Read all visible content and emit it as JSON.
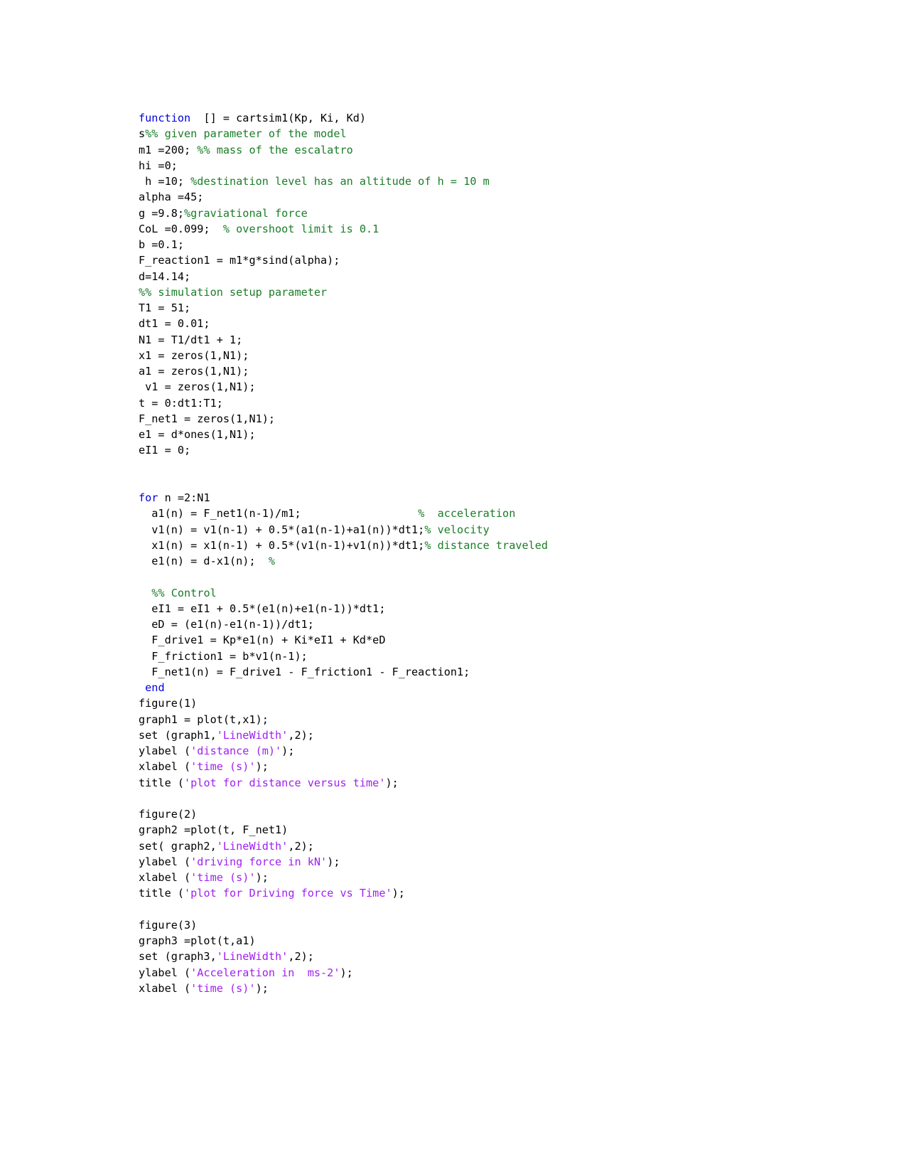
{
  "document": {
    "kind": "matlab-source-listing",
    "language": "MATLAB",
    "function_name": "cartsim1",
    "colors": {
      "background": "#ffffff",
      "text": "#000000",
      "keyword": "#0000e0",
      "comment": "#1a7d27",
      "string": "#a020f0"
    }
  },
  "code": {
    "lines": [
      [
        {
          "t": "function",
          "c": "kw"
        },
        {
          "t": "  [] = cartsim1(Kp, Ki, Kd)",
          "c": "plain"
        }
      ],
      [
        {
          "t": "s",
          "c": "plain"
        },
        {
          "t": "%% given parameter of the model",
          "c": "comment"
        }
      ],
      [
        {
          "t": "m1 =200; ",
          "c": "plain"
        },
        {
          "t": "%% mass of the escalatro",
          "c": "comment"
        }
      ],
      [
        {
          "t": "hi =0;",
          "c": "plain"
        }
      ],
      [
        {
          "t": " h =10; ",
          "c": "plain"
        },
        {
          "t": "%destination level has an altitude of h = 10 m",
          "c": "comment"
        }
      ],
      [
        {
          "t": "alpha =45;",
          "c": "plain"
        }
      ],
      [
        {
          "t": "g =9.8;",
          "c": "plain"
        },
        {
          "t": "%graviational force",
          "c": "comment"
        }
      ],
      [
        {
          "t": "CoL =0.099;  ",
          "c": "plain"
        },
        {
          "t": "% overshoot limit is 0.1",
          "c": "comment"
        }
      ],
      [
        {
          "t": "b =0.1;",
          "c": "plain"
        }
      ],
      [
        {
          "t": "F_reaction1 = m1*g*sind(alpha);",
          "c": "plain"
        }
      ],
      [
        {
          "t": "d=14.14;",
          "c": "plain"
        }
      ],
      [
        {
          "t": "%% simulation setup parameter",
          "c": "comment"
        }
      ],
      [
        {
          "t": "T1 = 51;",
          "c": "plain"
        }
      ],
      [
        {
          "t": "dt1 = 0.01;",
          "c": "plain"
        }
      ],
      [
        {
          "t": "N1 = T1/dt1 + 1;",
          "c": "plain"
        }
      ],
      [
        {
          "t": "x1 = zeros(1,N1);",
          "c": "plain"
        }
      ],
      [
        {
          "t": "a1 = zeros(1,N1);",
          "c": "plain"
        }
      ],
      [
        {
          "t": " v1 = zeros(1,N1);",
          "c": "plain"
        }
      ],
      [
        {
          "t": "t = 0:dt1:T1;",
          "c": "plain"
        }
      ],
      [
        {
          "t": "F_net1 = zeros(1,N1);",
          "c": "plain"
        }
      ],
      [
        {
          "t": "e1 = d*ones(1,N1);",
          "c": "plain"
        }
      ],
      [
        {
          "t": "eI1 = 0;",
          "c": "plain"
        }
      ],
      [],
      [],
      [
        {
          "t": "for",
          "c": "kw"
        },
        {
          "t": " n =2:N1",
          "c": "plain"
        }
      ],
      [
        {
          "t": "  a1(n) = F_net1(n-1)/m1;                  ",
          "c": "plain"
        },
        {
          "t": "%  acceleration",
          "c": "comment"
        }
      ],
      [
        {
          "t": "  v1(n) = v1(n-1) + 0.5*(a1(n-1)+a1(n))*dt1;",
          "c": "plain"
        },
        {
          "t": "% velocity",
          "c": "comment"
        }
      ],
      [
        {
          "t": "  x1(n) = x1(n-1) + 0.5*(v1(n-1)+v1(n))*dt1;",
          "c": "plain"
        },
        {
          "t": "% distance traveled",
          "c": "comment"
        }
      ],
      [
        {
          "t": "  e1(n) = d-x1(n);  ",
          "c": "plain"
        },
        {
          "t": "%",
          "c": "comment"
        }
      ],
      [],
      [
        {
          "t": "  ",
          "c": "plain"
        },
        {
          "t": "%% Control",
          "c": "comment"
        }
      ],
      [
        {
          "t": "  eI1 = eI1 + 0.5*(e1(n)+e1(n-1))*dt1;",
          "c": "plain"
        }
      ],
      [
        {
          "t": "  eD = (e1(n)-e1(n-1))/dt1;",
          "c": "plain"
        }
      ],
      [
        {
          "t": "  F_drive1 = Kp*e1(n) + Ki*eI1 + Kd*eD",
          "c": "plain"
        }
      ],
      [
        {
          "t": "  F_friction1 = b*v1(n-1);",
          "c": "plain"
        }
      ],
      [
        {
          "t": "  F_net1(n) = F_drive1 - F_friction1 - F_reaction1;",
          "c": "plain"
        }
      ],
      [
        {
          "t": " ",
          "c": "plain"
        },
        {
          "t": "end",
          "c": "kw"
        }
      ],
      [
        {
          "t": "figure(1)",
          "c": "plain"
        }
      ],
      [
        {
          "t": "graph1 = plot(t,x1);",
          "c": "plain"
        }
      ],
      [
        {
          "t": "set (graph1,",
          "c": "plain"
        },
        {
          "t": "'LineWidth'",
          "c": "str"
        },
        {
          "t": ",2);",
          "c": "plain"
        }
      ],
      [
        {
          "t": "ylabel (",
          "c": "plain"
        },
        {
          "t": "'distance (m)'",
          "c": "str"
        },
        {
          "t": ");",
          "c": "plain"
        }
      ],
      [
        {
          "t": "xlabel (",
          "c": "plain"
        },
        {
          "t": "'time (s)'",
          "c": "str"
        },
        {
          "t": ");",
          "c": "plain"
        }
      ],
      [
        {
          "t": "title (",
          "c": "plain"
        },
        {
          "t": "'plot for distance versus time'",
          "c": "str"
        },
        {
          "t": ");",
          "c": "plain"
        }
      ],
      [],
      [
        {
          "t": "figure(2)",
          "c": "plain"
        }
      ],
      [
        {
          "t": "graph2 =plot(t, F_net1)",
          "c": "plain"
        }
      ],
      [
        {
          "t": "set( graph2,",
          "c": "plain"
        },
        {
          "t": "'LineWidth'",
          "c": "str"
        },
        {
          "t": ",2);",
          "c": "plain"
        }
      ],
      [
        {
          "t": "ylabel (",
          "c": "plain"
        },
        {
          "t": "'driving force in kN'",
          "c": "str"
        },
        {
          "t": ");",
          "c": "plain"
        }
      ],
      [
        {
          "t": "xlabel (",
          "c": "plain"
        },
        {
          "t": "'time (s)'",
          "c": "str"
        },
        {
          "t": ");",
          "c": "plain"
        }
      ],
      [
        {
          "t": "title (",
          "c": "plain"
        },
        {
          "t": "'plot for Driving force vs Time'",
          "c": "str"
        },
        {
          "t": ");",
          "c": "plain"
        }
      ],
      [],
      [
        {
          "t": "figure(3)",
          "c": "plain"
        }
      ],
      [
        {
          "t": "graph3 =plot(t,a1)",
          "c": "plain"
        }
      ],
      [
        {
          "t": "set (graph3,",
          "c": "plain"
        },
        {
          "t": "'LineWidth'",
          "c": "str"
        },
        {
          "t": ",2);",
          "c": "plain"
        }
      ],
      [
        {
          "t": "ylabel (",
          "c": "plain"
        },
        {
          "t": "'Acceleration in  ms-2'",
          "c": "str"
        },
        {
          "t": ");",
          "c": "plain"
        }
      ],
      [
        {
          "t": "xlabel (",
          "c": "plain"
        },
        {
          "t": "'time (s)'",
          "c": "str"
        },
        {
          "t": ");",
          "c": "plain"
        }
      ]
    ]
  }
}
